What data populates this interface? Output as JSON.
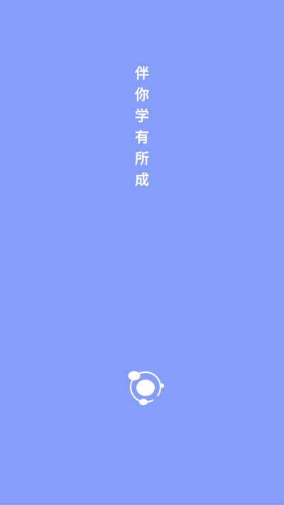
{
  "screen": {
    "name": "splash",
    "background_color": "#869ef9"
  },
  "slogan": {
    "chars": [
      "伴",
      "你",
      "学",
      "有",
      "所",
      "成"
    ],
    "color": "#ffffff"
  },
  "logo": {
    "icon": "app-logo-icon",
    "color": "#ffffff"
  }
}
